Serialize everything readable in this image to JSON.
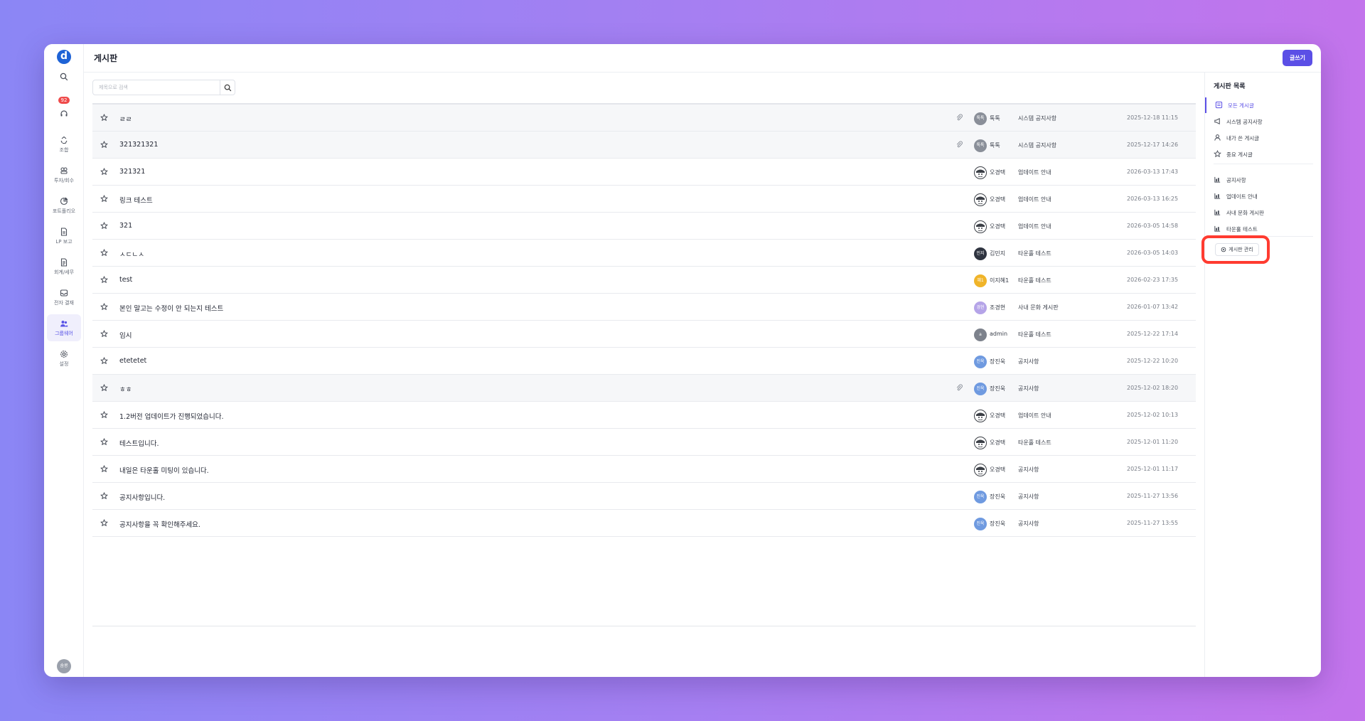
{
  "app": {
    "logo_letter": "d"
  },
  "rail": {
    "badge": "92",
    "items": [
      {
        "label": "조합",
        "icon": "recycle-icon",
        "active": false
      },
      {
        "label": "투자/회수",
        "icon": "handshake-icon",
        "active": false
      },
      {
        "label": "포트폴리오",
        "icon": "pie-chart-icon",
        "active": false
      },
      {
        "label": "LP 보고",
        "icon": "report-file-icon",
        "active": false
      },
      {
        "label": "회계/세무",
        "icon": "ledger-file-icon",
        "active": false
      },
      {
        "label": "전자 결재",
        "icon": "inbox-icon",
        "active": false
      },
      {
        "label": "그룹웨어",
        "icon": "users-icon",
        "active": true
      },
      {
        "label": "설정",
        "icon": "gear-icon",
        "active": false
      }
    ],
    "user_initials": "숨콩"
  },
  "header": {
    "title": "게시판",
    "write_button": "글쓰기"
  },
  "search": {
    "placeholder": "제목으로 검색"
  },
  "posts": [
    {
      "title": "ㄹㄹ",
      "has_attachment": true,
      "pinned": true,
      "avatar_text": "톡톡",
      "avatar_color": "#8a8f99",
      "author": "톡톡",
      "board": "시스템 공지사항",
      "date": "2025-12-18 11:15"
    },
    {
      "title": "321321321",
      "has_attachment": true,
      "pinned": true,
      "avatar_text": "톡톡",
      "avatar_color": "#8a8f99",
      "author": "톡톡",
      "board": "시스템 공지사항",
      "date": "2025-12-17 14:26"
    },
    {
      "title": "321321",
      "has_attachment": false,
      "pinned": false,
      "avatar_text": "",
      "avatar_color": "#3b3f46",
      "avatar_style": "cartoon",
      "author": "오경택",
      "board": "업데이트 안내",
      "date": "2026-03-13 17:43"
    },
    {
      "title": "링크 테스트",
      "has_attachment": false,
      "pinned": false,
      "avatar_text": "",
      "avatar_color": "#3b3f46",
      "avatar_style": "cartoon",
      "author": "오경택",
      "board": "업데이트 안내",
      "date": "2026-03-13 16:25"
    },
    {
      "title": "321",
      "has_attachment": false,
      "pinned": false,
      "avatar_text": "",
      "avatar_color": "#3b3f46",
      "avatar_style": "cartoon",
      "author": "오경택",
      "board": "업데이트 안내",
      "date": "2026-03-05 14:58"
    },
    {
      "title": "ㅅㄷㄴㅅ",
      "has_attachment": false,
      "pinned": false,
      "avatar_text": "민지",
      "avatar_color": "#2f3440",
      "author": "김민지",
      "board": "타운홀 테스트",
      "date": "2026-03-05 14:03"
    },
    {
      "title": "test",
      "has_attachment": false,
      "pinned": false,
      "avatar_text": "혜1",
      "avatar_color": "#f0b429",
      "author": "이지혜1",
      "board": "타운홀 테스트",
      "date": "2026-02-23 17:35"
    },
    {
      "title": "본인 말고는 수정이 안 되는지 테스트",
      "has_attachment": false,
      "pinned": false,
      "avatar_text": "경현",
      "avatar_color": "#b5a4e8",
      "author": "조경현",
      "board": "사내 문화 게시판",
      "date": "2026-01-07 13:42"
    },
    {
      "title": "임시",
      "has_attachment": false,
      "pinned": false,
      "avatar_text": "a",
      "avatar_color": "#7d828c",
      "author": "admin",
      "board": "타운홀 테스트",
      "date": "2025-12-22 17:14"
    },
    {
      "title": "etetetet",
      "has_attachment": false,
      "pinned": false,
      "avatar_text": "진욱",
      "avatar_color": "#6f9ae0",
      "author": "장진욱",
      "board": "공지사항",
      "date": "2025-12-22 10:20"
    },
    {
      "title": "ㅎㅎ",
      "has_attachment": true,
      "pinned": true,
      "avatar_text": "진욱",
      "avatar_color": "#6f9ae0",
      "author": "장진욱",
      "board": "공지사항",
      "date": "2025-12-02 18:20"
    },
    {
      "title": "1.2버전 업데이트가 진행되었습니다.",
      "has_attachment": false,
      "pinned": false,
      "avatar_text": "",
      "avatar_color": "#3b3f46",
      "avatar_style": "cartoon",
      "author": "오경택",
      "board": "업데이트 안내",
      "date": "2025-12-02 10:13"
    },
    {
      "title": "테스트입니다.",
      "has_attachment": false,
      "pinned": false,
      "avatar_text": "",
      "avatar_color": "#3b3f46",
      "avatar_style": "cartoon",
      "author": "오경택",
      "board": "타운홀 테스트",
      "date": "2025-12-01 11:20"
    },
    {
      "title": "내일은 타운홀 미팅이 있습니다.",
      "has_attachment": false,
      "pinned": false,
      "avatar_text": "",
      "avatar_color": "#3b3f46",
      "avatar_style": "cartoon",
      "author": "오경택",
      "board": "공지사항",
      "date": "2025-12-01 11:17"
    },
    {
      "title": "공지사항입니다.",
      "has_attachment": false,
      "pinned": false,
      "avatar_text": "진욱",
      "avatar_color": "#6f9ae0",
      "author": "장진욱",
      "board": "공지사항",
      "date": "2025-11-27 13:56"
    },
    {
      "title": "공지사항을 꼭 확인해주세요.",
      "has_attachment": false,
      "pinned": false,
      "avatar_text": "진욱",
      "avatar_color": "#6f9ae0",
      "author": "장진욱",
      "board": "공지사항",
      "date": "2025-11-27 13:55"
    }
  ],
  "panel": {
    "title": "게시판 목록",
    "filters": [
      {
        "label": "모든 게시글",
        "icon": "list-icon",
        "active": true
      },
      {
        "label": "시스템 공지사항",
        "icon": "megaphone-icon",
        "active": false
      },
      {
        "label": "내가 쓴 게시글",
        "icon": "user-icon",
        "active": false
      },
      {
        "label": "중요 게시글",
        "icon": "star-icon",
        "active": false
      }
    ],
    "boards": [
      {
        "label": "공지사항",
        "icon": "board-icon"
      },
      {
        "label": "업데이트 안내",
        "icon": "board-icon"
      },
      {
        "label": "사내 문화 게시판",
        "icon": "board-icon"
      },
      {
        "label": "타운홀 테스트",
        "icon": "board-icon"
      }
    ],
    "manage_button": "게시판 관리"
  },
  "colors": {
    "accent": "#5b4fe6",
    "highlight": "#ff3b30",
    "badge": "#ef4a4a"
  }
}
